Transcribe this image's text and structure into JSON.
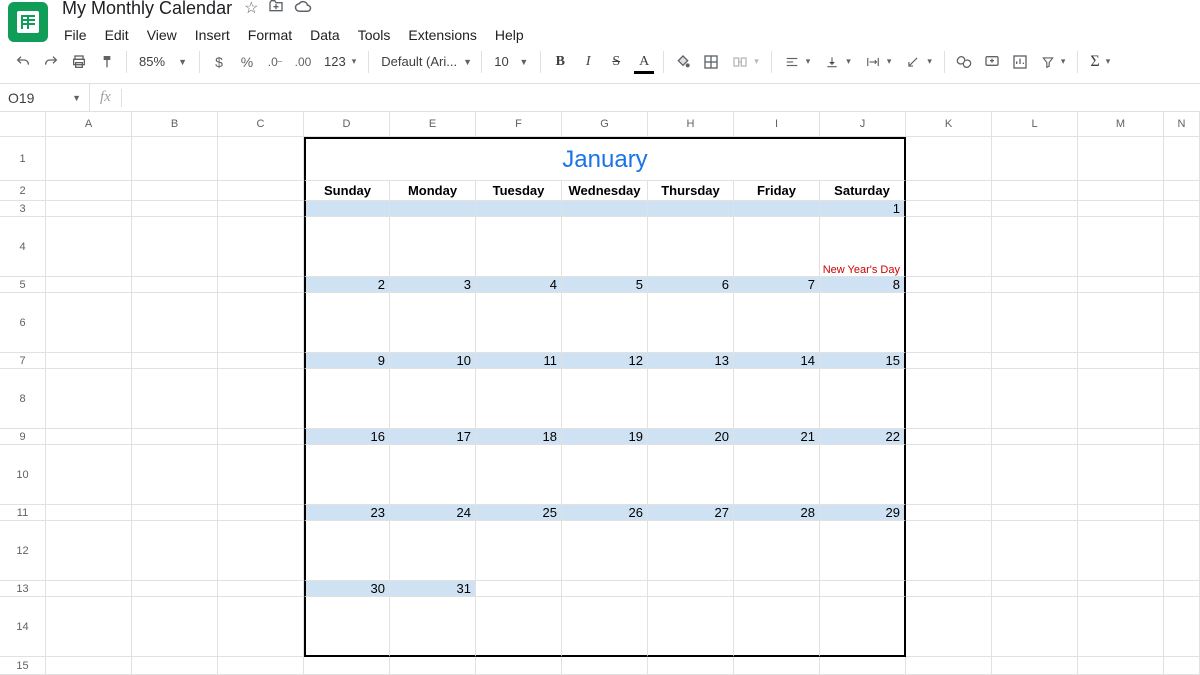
{
  "doc": {
    "title": "My Monthly Calendar"
  },
  "menu": {
    "file": "File",
    "edit": "Edit",
    "view": "View",
    "insert": "Insert",
    "format": "Format",
    "data": "Data",
    "tools": "Tools",
    "extensions": "Extensions",
    "help": "Help"
  },
  "toolbar": {
    "zoom": "85%",
    "font": "Default (Ari...",
    "fontsize": "10",
    "numfmt": "123"
  },
  "namebox": {
    "ref": "O19"
  },
  "cols": [
    "A",
    "B",
    "C",
    "D",
    "E",
    "F",
    "G",
    "H",
    "I",
    "J",
    "K",
    "L",
    "M",
    "N"
  ],
  "calendar": {
    "month": "January",
    "days": [
      "Sunday",
      "Monday",
      "Tuesday",
      "Wednesday",
      "Thursday",
      "Friday",
      "Saturday"
    ],
    "event": "New Year's Day",
    "weeks": [
      [
        "",
        "",
        "",
        "",
        "",
        "",
        "1"
      ],
      [
        "2",
        "3",
        "4",
        "5",
        "6",
        "7",
        "8"
      ],
      [
        "9",
        "10",
        "11",
        "12",
        "13",
        "14",
        "15"
      ],
      [
        "16",
        "17",
        "18",
        "19",
        "20",
        "21",
        "22"
      ],
      [
        "23",
        "24",
        "25",
        "26",
        "27",
        "28",
        "29"
      ],
      [
        "30",
        "31",
        "",
        "",
        "",
        "",
        ""
      ]
    ]
  },
  "rows": [
    "1",
    "2",
    "3",
    "4",
    "5",
    "6",
    "7",
    "8",
    "9",
    "10",
    "11",
    "12",
    "13",
    "14",
    "15"
  ]
}
